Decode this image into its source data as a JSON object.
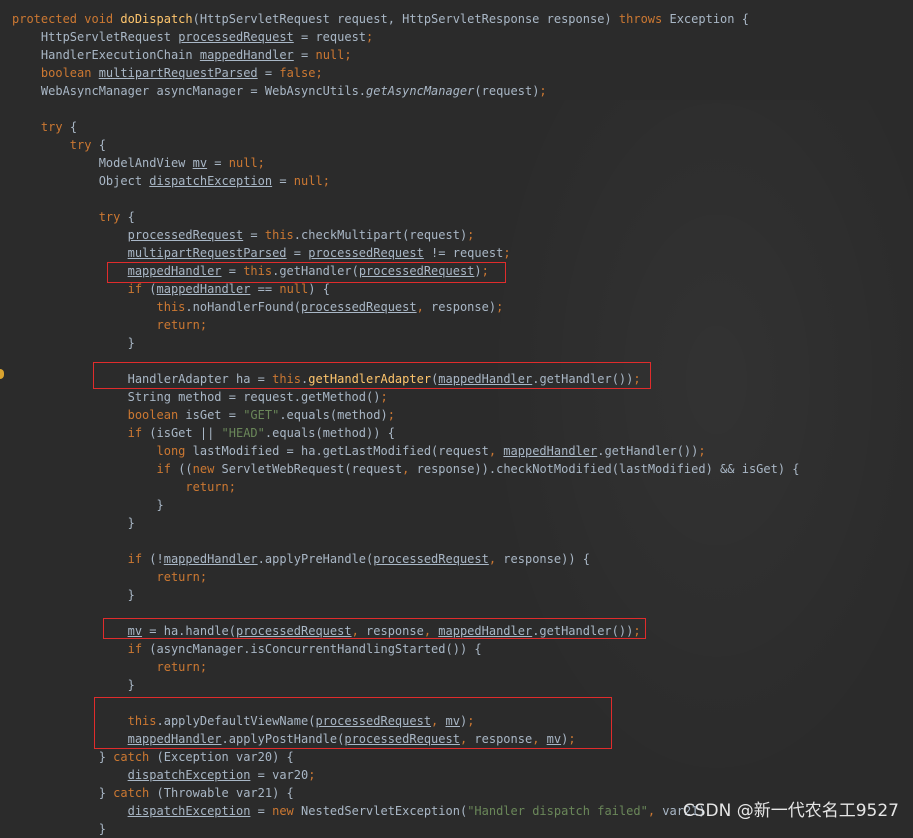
{
  "lines": [
    {
      "indent": 0,
      "tokens": [
        {
          "t": "protected void ",
          "c": "kw"
        },
        {
          "t": "doDispatch",
          "c": "fn"
        },
        {
          "t": "(HttpServletRequest request, HttpServletResponse response) "
        },
        {
          "t": "throws ",
          "c": "kw"
        },
        {
          "t": "Exception {"
        }
      ]
    },
    {
      "indent": 4,
      "tokens": [
        {
          "t": "HttpServletRequest "
        },
        {
          "t": "processedRequest",
          "c": "ul"
        },
        {
          "t": " = request"
        },
        {
          "t": ";",
          "c": "kw"
        }
      ]
    },
    {
      "indent": 4,
      "tokens": [
        {
          "t": "HandlerExecutionChain "
        },
        {
          "t": "mappedHandler",
          "c": "ul"
        },
        {
          "t": " = "
        },
        {
          "t": "null;",
          "c": "kw"
        }
      ]
    },
    {
      "indent": 4,
      "tokens": [
        {
          "t": "boolean ",
          "c": "kw"
        },
        {
          "t": "multipartRequestParsed",
          "c": "ul"
        },
        {
          "t": " = "
        },
        {
          "t": "false;",
          "c": "kw"
        }
      ]
    },
    {
      "indent": 4,
      "tokens": [
        {
          "t": "WebAsyncManager asyncManager = WebAsyncUtils."
        },
        {
          "t": "getAsyncManager",
          "c": "it"
        },
        {
          "t": "(request)"
        },
        {
          "t": ";",
          "c": "kw"
        }
      ]
    },
    {
      "indent": 0,
      "tokens": []
    },
    {
      "indent": 4,
      "tokens": [
        {
          "t": "try ",
          "c": "kw"
        },
        {
          "t": "{"
        }
      ]
    },
    {
      "indent": 8,
      "tokens": [
        {
          "t": "try ",
          "c": "kw"
        },
        {
          "t": "{"
        }
      ]
    },
    {
      "indent": 12,
      "tokens": [
        {
          "t": "ModelAndView "
        },
        {
          "t": "mv",
          "c": "ul"
        },
        {
          "t": " = "
        },
        {
          "t": "null;",
          "c": "kw"
        }
      ]
    },
    {
      "indent": 12,
      "tokens": [
        {
          "t": "Object "
        },
        {
          "t": "dispatchException",
          "c": "ul"
        },
        {
          "t": " = "
        },
        {
          "t": "null;",
          "c": "kw"
        }
      ]
    },
    {
      "indent": 0,
      "tokens": []
    },
    {
      "indent": 12,
      "tokens": [
        {
          "t": "try ",
          "c": "kw"
        },
        {
          "t": "{"
        }
      ]
    },
    {
      "indent": 16,
      "tokens": [
        {
          "t": "processedRequest",
          "c": "ul"
        },
        {
          "t": " = "
        },
        {
          "t": "this",
          "c": "kw"
        },
        {
          "t": ".checkMultipart(request)"
        },
        {
          "t": ";",
          "c": "kw"
        }
      ]
    },
    {
      "indent": 16,
      "tokens": [
        {
          "t": "multipartRequestParsed",
          "c": "ul"
        },
        {
          "t": " = "
        },
        {
          "t": "processedRequest",
          "c": "ul"
        },
        {
          "t": " != request"
        },
        {
          "t": ";",
          "c": "kw"
        }
      ]
    },
    {
      "indent": 16,
      "tokens": [
        {
          "t": "mappedHandler",
          "c": "ul"
        },
        {
          "t": " = "
        },
        {
          "t": "this",
          "c": "kw"
        },
        {
          "t": ".getHandler("
        },
        {
          "t": "processedRequest",
          "c": "ul"
        },
        {
          "t": ")"
        },
        {
          "t": ";",
          "c": "kw"
        }
      ]
    },
    {
      "indent": 16,
      "tokens": [
        {
          "t": "if ",
          "c": "kw"
        },
        {
          "t": "("
        },
        {
          "t": "mappedHandler",
          "c": "ul"
        },
        {
          "t": " == "
        },
        {
          "t": "null",
          "c": "kw"
        },
        {
          "t": ") {"
        }
      ]
    },
    {
      "indent": 20,
      "tokens": [
        {
          "t": "this",
          "c": "kw"
        },
        {
          "t": ".noHandlerFound("
        },
        {
          "t": "processedRequest",
          "c": "ul"
        },
        {
          "t": ", ",
          "c": "kw"
        },
        {
          "t": "response)"
        },
        {
          "t": ";",
          "c": "kw"
        }
      ]
    },
    {
      "indent": 20,
      "tokens": [
        {
          "t": "return;",
          "c": "kw"
        }
      ]
    },
    {
      "indent": 16,
      "tokens": [
        {
          "t": "}"
        }
      ]
    },
    {
      "indent": 0,
      "tokens": []
    },
    {
      "indent": 16,
      "tokens": [
        {
          "t": "HandlerAdapter ha = "
        },
        {
          "t": "this",
          "c": "kw"
        },
        {
          "t": "."
        },
        {
          "t": "getHandlerAdapter",
          "c": "fn"
        },
        {
          "t": "("
        },
        {
          "t": "mappedHandler",
          "c": "ul"
        },
        {
          "t": ".getHandler())"
        },
        {
          "t": ";",
          "c": "kw"
        }
      ]
    },
    {
      "indent": 16,
      "tokens": [
        {
          "t": "String method = request.getMethod()"
        },
        {
          "t": ";",
          "c": "kw"
        }
      ]
    },
    {
      "indent": 16,
      "tokens": [
        {
          "t": "boolean ",
          "c": "kw"
        },
        {
          "t": "isGet = "
        },
        {
          "t": "\"GET\"",
          "c": "str"
        },
        {
          "t": ".equals(method)"
        },
        {
          "t": ";",
          "c": "kw"
        }
      ]
    },
    {
      "indent": 16,
      "tokens": [
        {
          "t": "if ",
          "c": "kw"
        },
        {
          "t": "(isGet || "
        },
        {
          "t": "\"HEAD\"",
          "c": "str"
        },
        {
          "t": ".equals(method)) {"
        }
      ]
    },
    {
      "indent": 20,
      "tokens": [
        {
          "t": "long ",
          "c": "kw"
        },
        {
          "t": "lastModified = ha.getLastModified(request"
        },
        {
          "t": ", ",
          "c": "kw"
        },
        {
          "t": "mappedHandler",
          "c": "ul"
        },
        {
          "t": ".getHandler())"
        },
        {
          "t": ";",
          "c": "kw"
        }
      ]
    },
    {
      "indent": 20,
      "tokens": [
        {
          "t": "if ",
          "c": "kw"
        },
        {
          "t": "(("
        },
        {
          "t": "new ",
          "c": "kw"
        },
        {
          "t": "ServletWebRequest(request"
        },
        {
          "t": ", ",
          "c": "kw"
        },
        {
          "t": "response)).checkNotModified(lastModified) && isGet) {"
        }
      ]
    },
    {
      "indent": 24,
      "tokens": [
        {
          "t": "return;",
          "c": "kw"
        }
      ]
    },
    {
      "indent": 20,
      "tokens": [
        {
          "t": "}"
        }
      ]
    },
    {
      "indent": 16,
      "tokens": [
        {
          "t": "}"
        }
      ]
    },
    {
      "indent": 0,
      "tokens": []
    },
    {
      "indent": 16,
      "tokens": [
        {
          "t": "if ",
          "c": "kw"
        },
        {
          "t": "(!"
        },
        {
          "t": "mappedHandler",
          "c": "ul"
        },
        {
          "t": ".applyPreHandle("
        },
        {
          "t": "processedRequest",
          "c": "ul"
        },
        {
          "t": ", ",
          "c": "kw"
        },
        {
          "t": "response)) {"
        }
      ]
    },
    {
      "indent": 20,
      "tokens": [
        {
          "t": "return;",
          "c": "kw"
        }
      ]
    },
    {
      "indent": 16,
      "tokens": [
        {
          "t": "}"
        }
      ]
    },
    {
      "indent": 0,
      "tokens": []
    },
    {
      "indent": 16,
      "tokens": [
        {
          "t": "mv",
          "c": "ul"
        },
        {
          "t": " = ha.handle("
        },
        {
          "t": "processedRequest",
          "c": "ul"
        },
        {
          "t": ", ",
          "c": "kw"
        },
        {
          "t": "response"
        },
        {
          "t": ", ",
          "c": "kw"
        },
        {
          "t": "mappedHandler",
          "c": "ul"
        },
        {
          "t": ".getHandler())"
        },
        {
          "t": ";",
          "c": "kw"
        }
      ]
    },
    {
      "indent": 16,
      "tokens": [
        {
          "t": "if ",
          "c": "kw"
        },
        {
          "t": "(asyncManager.isConcurrentHandlingStarted()) {"
        }
      ]
    },
    {
      "indent": 20,
      "tokens": [
        {
          "t": "return;",
          "c": "kw"
        }
      ]
    },
    {
      "indent": 16,
      "tokens": [
        {
          "t": "}"
        }
      ]
    },
    {
      "indent": 0,
      "tokens": []
    },
    {
      "indent": 16,
      "tokens": [
        {
          "t": "this",
          "c": "kw"
        },
        {
          "t": ".applyDefaultViewName("
        },
        {
          "t": "processedRequest",
          "c": "ul"
        },
        {
          "t": ", ",
          "c": "kw"
        },
        {
          "t": "mv",
          "c": "ul"
        },
        {
          "t": ")"
        },
        {
          "t": ";",
          "c": "kw"
        }
      ]
    },
    {
      "indent": 16,
      "tokens": [
        {
          "t": "mappedHandler",
          "c": "ul"
        },
        {
          "t": ".applyPostHandle("
        },
        {
          "t": "processedRequest",
          "c": "ul"
        },
        {
          "t": ", ",
          "c": "kw"
        },
        {
          "t": "response"
        },
        {
          "t": ", ",
          "c": "kw"
        },
        {
          "t": "mv",
          "c": "ul"
        },
        {
          "t": ")"
        },
        {
          "t": ";",
          "c": "kw"
        }
      ]
    },
    {
      "indent": 12,
      "tokens": [
        {
          "t": "} "
        },
        {
          "t": "catch ",
          "c": "kw"
        },
        {
          "t": "(Exception var20) {"
        }
      ]
    },
    {
      "indent": 16,
      "tokens": [
        {
          "t": "dispatchException",
          "c": "ul"
        },
        {
          "t": " = var20"
        },
        {
          "t": ";",
          "c": "kw"
        }
      ]
    },
    {
      "indent": 12,
      "tokens": [
        {
          "t": "} "
        },
        {
          "t": "catch ",
          "c": "kw"
        },
        {
          "t": "(Throwable var21) {"
        }
      ]
    },
    {
      "indent": 16,
      "tokens": [
        {
          "t": "dispatchException",
          "c": "ul"
        },
        {
          "t": " = "
        },
        {
          "t": "new ",
          "c": "kw"
        },
        {
          "t": "NestedServletException("
        },
        {
          "t": "\"Handler dispatch failed\"",
          "c": "str"
        },
        {
          "t": ", ",
          "c": "kw"
        },
        {
          "t": "var21)"
        }
      ]
    },
    {
      "indent": 12,
      "tokens": [
        {
          "t": "}"
        }
      ]
    }
  ],
  "watermark": "CSDN @新一代农名工9527",
  "highlight_color": "#e02c2c"
}
